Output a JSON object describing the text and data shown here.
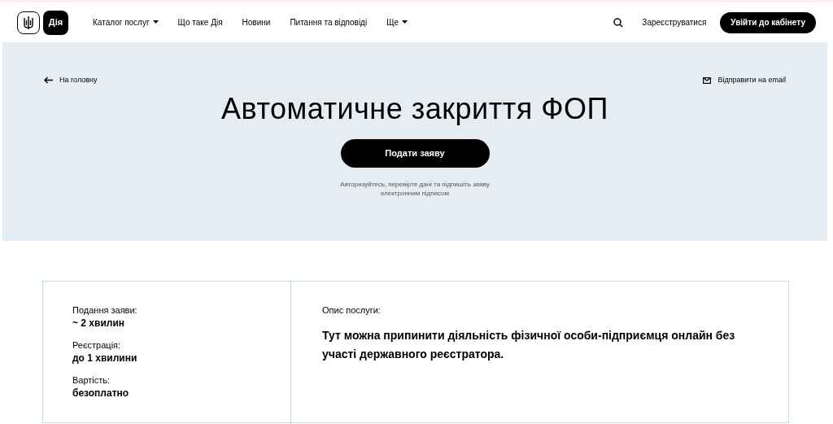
{
  "header": {
    "logo_text": "Дія",
    "nav": [
      {
        "label": "Каталог послуг",
        "dropdown": true
      },
      {
        "label": "Що таке Дія",
        "dropdown": false
      },
      {
        "label": "Новини",
        "dropdown": false
      },
      {
        "label": "Питання та відповіді",
        "dropdown": false
      },
      {
        "label": "Ще",
        "dropdown": true
      }
    ],
    "register": "Зареєструватися",
    "login": "Увійти до кабінету"
  },
  "hero": {
    "back": "На головну",
    "email": "Відправити на email",
    "title": "Автоматичне закриття ФОП",
    "apply": "Подати заяву",
    "note": "Авторизуйтесь, перевірте дані та підпишіть заяву електронним підписом"
  },
  "info": {
    "facts": [
      {
        "label": "Подання заяви:",
        "value": "~ 2 хвилин"
      },
      {
        "label": "Реєстрація:",
        "value": "до 1 хвилини"
      },
      {
        "label": "Вартість:",
        "value": "безоплатно"
      }
    ],
    "description_label": "Опис послуги:",
    "description": "Тут можна припинити діяльність фізичної особи-підприємця онлайн без участі державного реєстратора."
  }
}
